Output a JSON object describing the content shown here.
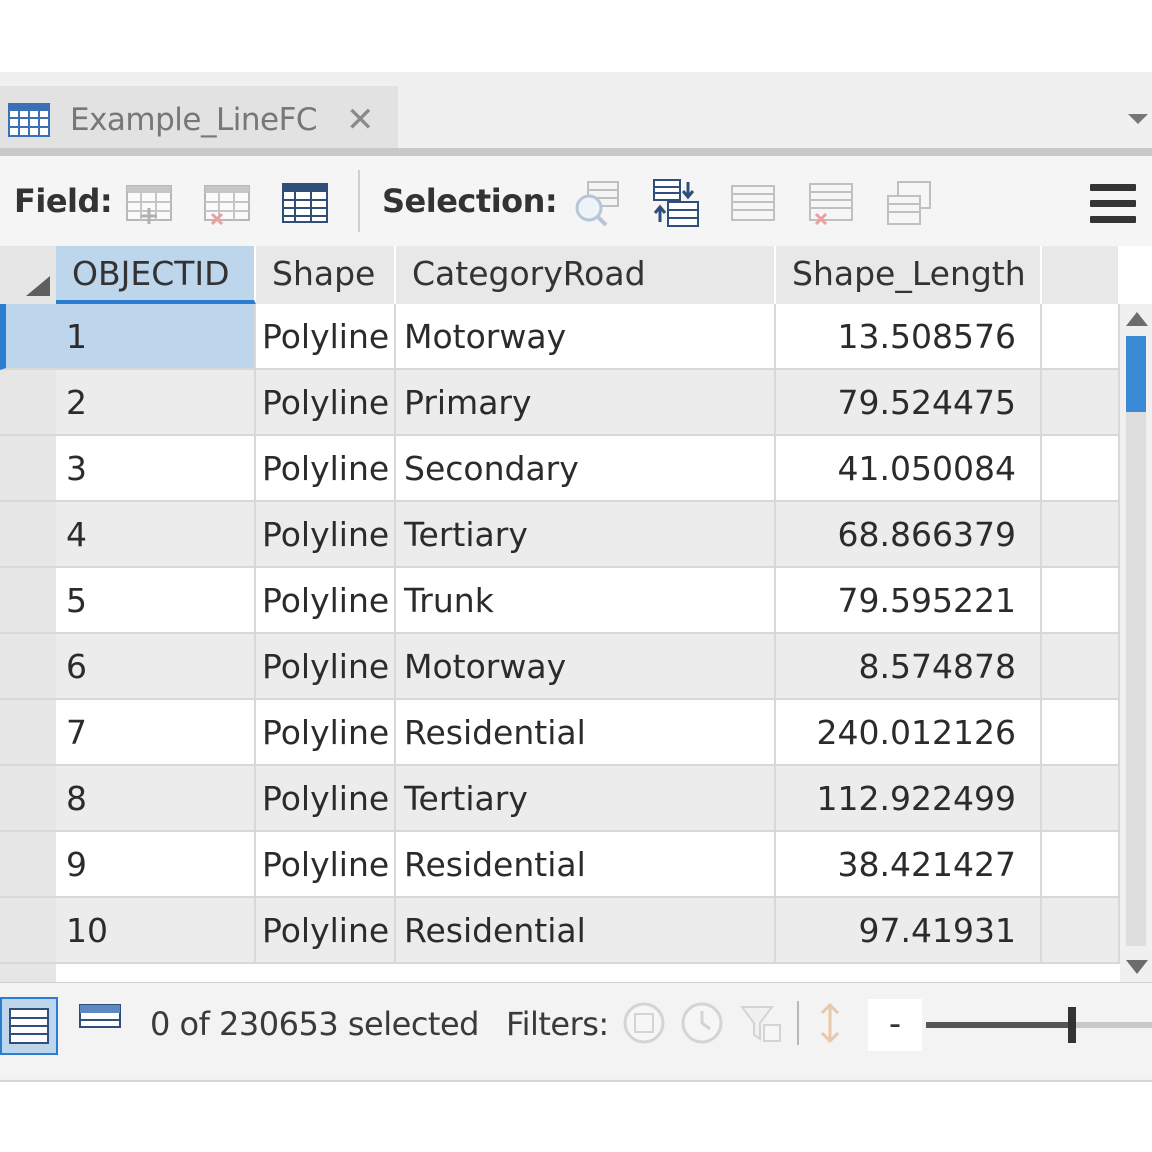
{
  "tab": {
    "title": "Example_LineFC",
    "close": "✕"
  },
  "toolbar": {
    "field_label": "Field:",
    "selection_label": "Selection:"
  },
  "columns": [
    "OBJECTID",
    "Shape",
    "CategoryRoad",
    "Shape_Length"
  ],
  "rows": [
    {
      "id": "1",
      "shape": "Polyline",
      "category": "Motorway",
      "length": "13.508576"
    },
    {
      "id": "2",
      "shape": "Polyline",
      "category": "Primary",
      "length": "79.524475"
    },
    {
      "id": "3",
      "shape": "Polyline",
      "category": "Secondary",
      "length": "41.050084"
    },
    {
      "id": "4",
      "shape": "Polyline",
      "category": "Tertiary",
      "length": "68.866379"
    },
    {
      "id": "5",
      "shape": "Polyline",
      "category": "Trunk",
      "length": "79.595221"
    },
    {
      "id": "6",
      "shape": "Polyline",
      "category": "Motorway",
      "length": "8.574878"
    },
    {
      "id": "7",
      "shape": "Polyline",
      "category": "Residential",
      "length": "240.012126"
    },
    {
      "id": "8",
      "shape": "Polyline",
      "category": "Tertiary",
      "length": "112.922499"
    },
    {
      "id": "9",
      "shape": "Polyline",
      "category": "Residential",
      "length": "38.421427"
    },
    {
      "id": "10",
      "shape": "Polyline",
      "category": "Residential",
      "length": "97.41931"
    }
  ],
  "status": {
    "selected_text": "0 of 230653 selected",
    "filters_label": "Filters:",
    "zoom_minus": "-",
    "zoom_level": 0.65
  },
  "colors": {
    "accent": "#2a7dd0",
    "selection": "#bdd6ec",
    "alt_row": "#ececec"
  }
}
